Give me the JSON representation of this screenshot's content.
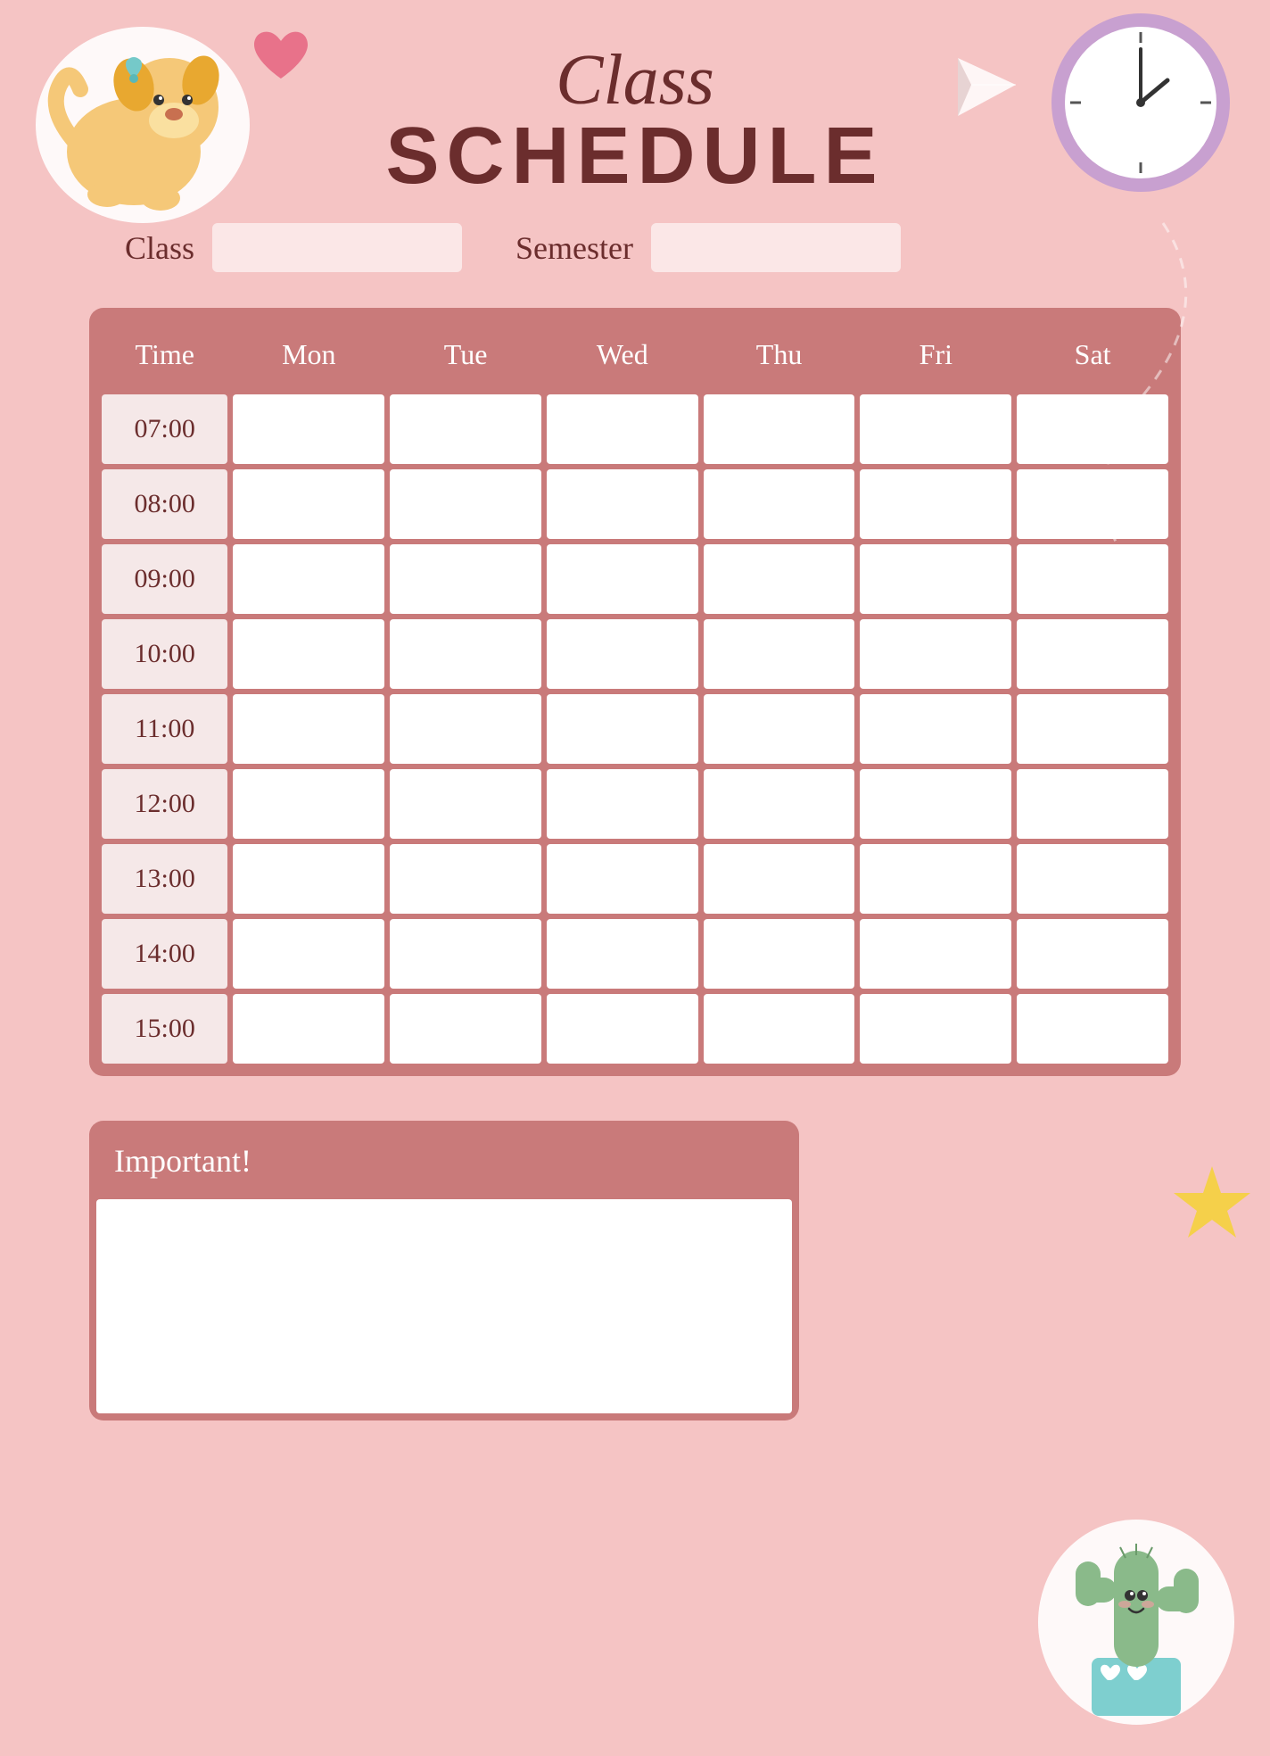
{
  "page": {
    "bg_color": "#f5c4c4",
    "title_line1": "Class",
    "title_line2": "SCHEDULE"
  },
  "form": {
    "class_label": "Class",
    "semester_label": "Semester",
    "class_value": "",
    "semester_value": ""
  },
  "table": {
    "headers": [
      "Time",
      "Mon",
      "Tue",
      "Wed",
      "Thu",
      "Fri",
      "Sat"
    ],
    "time_slots": [
      "07:00",
      "08:00",
      "09:00",
      "10:00",
      "11:00",
      "12:00",
      "13:00",
      "14:00",
      "15:00"
    ]
  },
  "important": {
    "label": "Important!"
  },
  "colors": {
    "bg": "#f5c4c4",
    "header_rose": "#c97a7a",
    "text_dark": "#6b2d2d",
    "white": "#ffffff",
    "cell_bg": "#f5e8e8"
  }
}
